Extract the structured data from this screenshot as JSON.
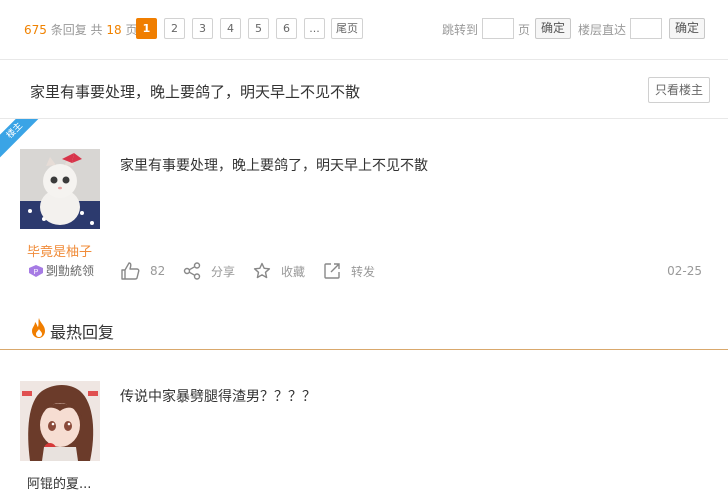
{
  "pager": {
    "total_replies": "675",
    "replies_label": "条回复 共",
    "total_pages": "18",
    "pages_suffix": "页",
    "pages": [
      "1",
      "2",
      "3",
      "4",
      "5",
      "6"
    ],
    "active_page": "1",
    "ellipsis": "...",
    "last_page": "尾页",
    "jump_to": "跳转到",
    "page_unit": "页",
    "confirm": "确定",
    "floor_jump": "楼层直达",
    "confirm2": "确定",
    "accent_color": "#f07e00"
  },
  "thread": {
    "title": "家里有事要处理，晚上要鸽了，明天早上不见不散",
    "only_op_button": "只看楼主"
  },
  "op_post": {
    "badge": "楼主",
    "username": "毕竟是柚子",
    "title_badge": "㓸勯統领",
    "content": "家里有事要处理，晚上要鸽了，明天早上不见不散",
    "likes": "82",
    "share": "分享",
    "collect": "收藏",
    "forward": "转发",
    "date": "02-25"
  },
  "hot_replies": {
    "header": "最热回复",
    "items": [
      {
        "username": "阿锟的夏...",
        "content": "传说中家暴劈腿得渣男？？？？"
      }
    ]
  }
}
